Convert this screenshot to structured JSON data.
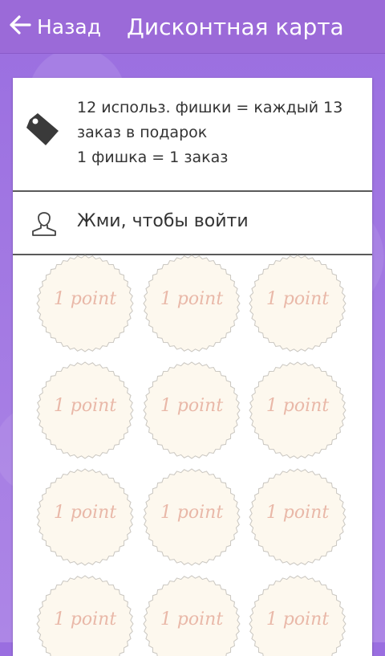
{
  "header": {
    "back_label": "Назад",
    "title": "Дисконтная карта"
  },
  "info": {
    "line1": "12 использ. фишки = каждый 13",
    "line2": "заказ в подарок",
    "line3": "1 фишка = 1 заказ"
  },
  "login": {
    "label": "Жми, чтобы войти"
  },
  "stamps": {
    "label": "1 point",
    "count": 12
  },
  "colors": {
    "header_bg": "#9b6ad8",
    "stamp_fill": "#fdf8ee",
    "stamp_text": "#e9b8a8"
  },
  "icons": {
    "back": "arrow-left-icon",
    "tag": "tag-icon",
    "user": "user-icon"
  }
}
